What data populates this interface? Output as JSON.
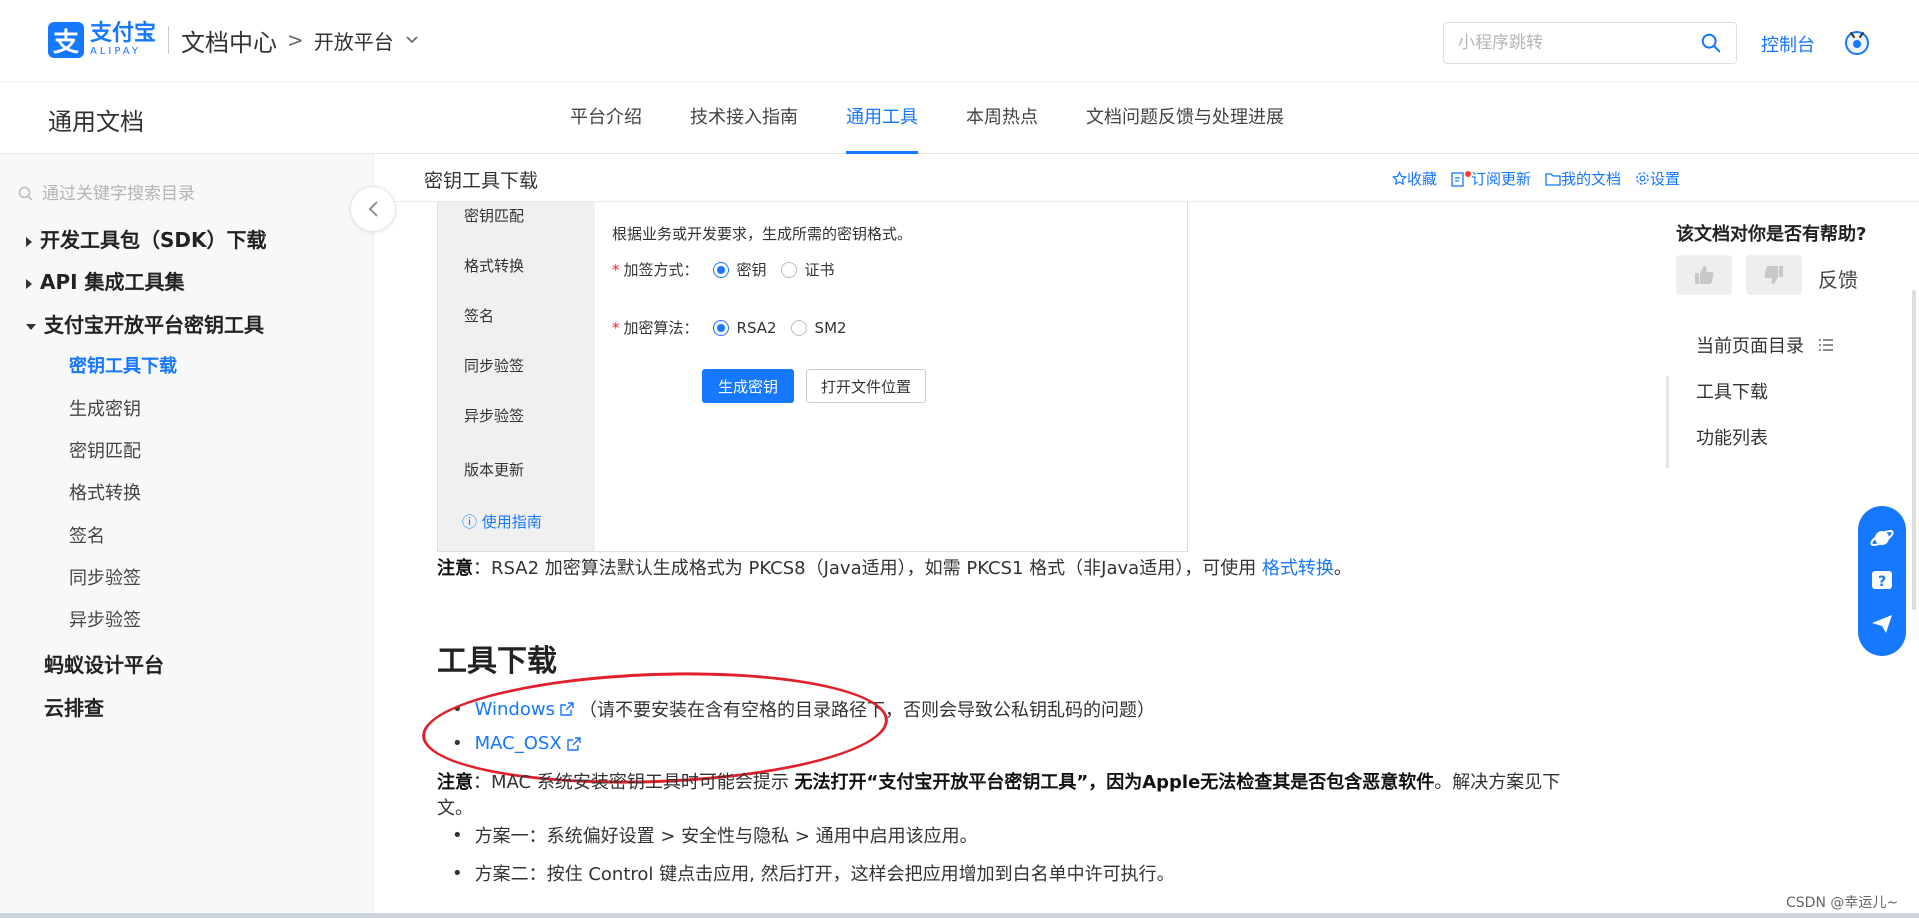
{
  "header": {
    "logo_char": "支",
    "logo_cn": "支付宝",
    "logo_en": "ALIPAY",
    "doc_center": "文档中心",
    "crumb_sep": ">",
    "platform": "开放平台",
    "search_placeholder": "小程序跳转",
    "console": "控制台"
  },
  "subnav": {
    "title": "通用文档",
    "tabs": [
      "平台介绍",
      "技术接入指南",
      "通用工具",
      "本周热点",
      "文档问题反馈与处理进展"
    ],
    "active_tab": 2
  },
  "sidebar": {
    "search_placeholder": "通过关键字搜索目录",
    "items": [
      {
        "label": "开发工具包（SDK）下载",
        "level": 0,
        "arrow": "right"
      },
      {
        "label": "API 集成工具集",
        "level": 0,
        "arrow": "right"
      },
      {
        "label": "支付宝开放平台密钥工具",
        "level": 0,
        "arrow": "down"
      },
      {
        "label": "密钥工具下载",
        "level": 1,
        "active": true
      },
      {
        "label": "生成密钥",
        "level": 1
      },
      {
        "label": "密钥匹配",
        "level": 1
      },
      {
        "label": "格式转换",
        "level": 1
      },
      {
        "label": "签名",
        "level": 1
      },
      {
        "label": "同步验签",
        "level": 1
      },
      {
        "label": "异步验签",
        "level": 1
      },
      {
        "label": "蚂蚁设计平台",
        "level": 0
      },
      {
        "label": "云排查",
        "level": 0
      }
    ]
  },
  "doc": {
    "title": "密钥工具下载",
    "actions": {
      "favorite": "收藏",
      "subscribe": "订阅更新",
      "my_docs": "我的文档",
      "settings": "设置"
    },
    "screenshot": {
      "menu": [
        "密钥匹配",
        "格式转换",
        "签名",
        "同步验签",
        "异步验签",
        "版本更新"
      ],
      "guide": "使用指南",
      "desc": "根据业务或开发要求，生成所需的密钥格式。",
      "sign_label": "加签方式：",
      "sign_opt1": "密钥",
      "sign_opt2": "证书",
      "algo_label": "加密算法：",
      "algo_opt1": "RSA2",
      "algo_opt2": "SM2",
      "btn_generate": "生成密钥",
      "btn_open": "打开文件位置"
    },
    "note1_label": "注意",
    "note1_text": "：RSA2 加密算法默认生成格式为 PKCS8（Java适用），如需 PKCS1 格式（非Java适用），可使用 ",
    "note1_link": "格式转换",
    "note1_end": "。",
    "section_title": "工具下载",
    "download_windows": "Windows",
    "download_windows_note": "（请不要安装在含有空格的目录路径下，否则会导致公私钥乱码的问题）",
    "download_mac": "MAC_OSX",
    "note2_label": "注意",
    "note2_text": "：MAC 系统安装密钥工具时可能会提示 ",
    "note2_bold": "无法打开“支付宝开放平台密钥工具”，因为Apple无法检查其是否包含恶意软件",
    "note2_end": "。解决方案见下",
    "note2_wrap": "文。",
    "solution1": "方案一：系统偏好设置 > 安全性与隐私 > 通用中启用该应用。",
    "solution2": "方案二：按住 Control 键点击应用, 然后打开，这样会把应用增加到白名单中许可执行。"
  },
  "right_panel": {
    "help_title": "该文档对你是否有帮助?",
    "feedback": "反馈",
    "toc_title": "当前页面目录",
    "toc_items": [
      "工具下载",
      "功能列表"
    ]
  },
  "watermark": "CSDN @幸运儿~",
  "colors": {
    "brand": "#1677ff",
    "annotation": "#e0202a"
  }
}
